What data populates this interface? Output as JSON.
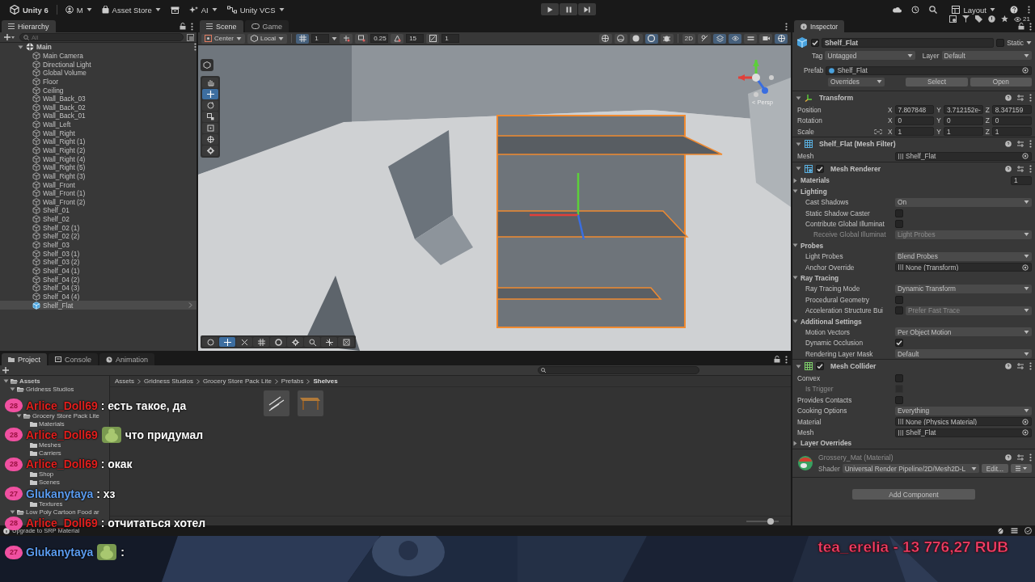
{
  "toolbar": {
    "title": "Unity 6",
    "account": "M",
    "asset_store": "Asset Store",
    "ai": "AI",
    "vcs": "Unity VCS",
    "layout": "Layout"
  },
  "hierarchy": {
    "title": "Hierarchy",
    "placeholder": "All",
    "items": [
      {
        "label": "Main",
        "expanded": true,
        "children": [
          {
            "label": "Main Camera",
            "selected": false,
            "prefab": false
          },
          {
            "label": "Directional Light",
            "selected": false,
            "prefab": false
          },
          {
            "label": "Global Volume",
            "selected": false,
            "prefab": false
          },
          {
            "label": "Floor",
            "selected": false,
            "prefab": false
          },
          {
            "label": "Ceiling",
            "selected": false,
            "prefab": false
          },
          {
            "label": "Wall_Back_03",
            "selected": false,
            "prefab": false
          },
          {
            "label": "Wall_Back_02",
            "selected": false,
            "prefab": false
          },
          {
            "label": "Wall_Back_01",
            "selected": false,
            "prefab": false
          },
          {
            "label": "Wall_Left",
            "selected": false,
            "prefab": false
          },
          {
            "label": "Wall_Right",
            "selected": false,
            "prefab": false
          },
          {
            "label": "Wall_Right (1)",
            "selected": false,
            "prefab": false
          },
          {
            "label": "Wall_Right (2)",
            "selected": false,
            "prefab": false
          },
          {
            "label": "Wall_Right (4)",
            "selected": false,
            "prefab": false
          },
          {
            "label": "Wall_Right (5)",
            "selected": false,
            "prefab": false
          },
          {
            "label": "Wall_Right (3)",
            "selected": false,
            "prefab": false
          },
          {
            "label": "Wall_Front",
            "selected": false,
            "prefab": false
          },
          {
            "label": "Wall_Front (1)",
            "selected": false,
            "prefab": false
          },
          {
            "label": "Wall_Front (2)",
            "selected": false,
            "prefab": false
          },
          {
            "label": "Shelf_01",
            "selected": false,
            "prefab": false
          },
          {
            "label": "Shelf_02",
            "selected": false,
            "prefab": false
          },
          {
            "label": "Shelf_02 (1)",
            "selected": false,
            "prefab": false
          },
          {
            "label": "Shelf_02 (2)",
            "selected": false,
            "prefab": false
          },
          {
            "label": "Shelf_03",
            "selected": false,
            "prefab": false
          },
          {
            "label": "Shelf_03 (1)",
            "selected": false,
            "prefab": false
          },
          {
            "label": "Shelf_03 (2)",
            "selected": false,
            "prefab": false
          },
          {
            "label": "Shelf_04 (1)",
            "selected": false,
            "prefab": false
          },
          {
            "label": "Shelf_04 (2)",
            "selected": false,
            "prefab": false
          },
          {
            "label": "Shelf_04 (3)",
            "selected": false,
            "prefab": false
          },
          {
            "label": "Shelf_04 (4)",
            "selected": false,
            "prefab": false
          },
          {
            "label": "Shelf_Flat",
            "selected": true,
            "prefab": true
          }
        ]
      }
    ]
  },
  "scene": {
    "tabs": [
      {
        "label": "Scene",
        "selected": true
      },
      {
        "label": "Game",
        "selected": false
      }
    ],
    "pivot": "Center",
    "space": "Local",
    "grid_size": "1",
    "snap": "0.25",
    "angle": "15",
    "scale_snap": "1",
    "mode_2d": "2D",
    "persp": "< Persp"
  },
  "inspector": {
    "title": "Inspector",
    "object_name": "Shelf_Flat",
    "active": true,
    "static_label": "Static",
    "static": false,
    "tag_label": "Tag",
    "tag": "Untagged",
    "layer_label": "Layer",
    "layer": "Default",
    "prefab_label": "Prefab",
    "prefab": "Shelf_Flat",
    "overrides": "Overrides",
    "select": "Select",
    "open": "Open",
    "components": [
      {
        "kind": "transform",
        "title": "Transform",
        "expanded": true,
        "rows": [
          {
            "kind": "vector",
            "label": "Position",
            "values": [
              {
                "axis": "X",
                "value": "7.807848"
              },
              {
                "axis": "Y",
                "value": "3.712152e-"
              },
              {
                "axis": "Z",
                "value": "8.347159"
              }
            ]
          },
          {
            "kind": "vector",
            "label": "Rotation",
            "values": [
              {
                "axis": "X",
                "value": "0"
              },
              {
                "axis": "Y",
                "value": "0"
              },
              {
                "axis": "Z",
                "value": "0"
              }
            ]
          },
          {
            "kind": "vector",
            "label": "Scale",
            "constrain": true,
            "values": [
              {
                "axis": "X",
                "value": "1"
              },
              {
                "axis": "Y",
                "value": "1"
              },
              {
                "axis": "Z",
                "value": "1"
              }
            ]
          }
        ]
      },
      {
        "kind": "filter",
        "title": "Shelf_Flat (Mesh Filter)",
        "expanded": true,
        "rows": [
          {
            "kind": "object",
            "label": "Mesh",
            "value": "Shelf_Flat"
          }
        ]
      },
      {
        "kind": "renderer",
        "title": "Mesh Renderer",
        "enabled": true,
        "expanded": true,
        "rows": [
          {
            "kind": "section",
            "label": "Materials",
            "expanded": false,
            "value": "1"
          },
          {
            "kind": "section",
            "label": "Lighting",
            "expanded": true,
            "rows": [
              {
                "kind": "dropdown",
                "label": "Cast Shadows",
                "value": "On",
                "disabled": false
              },
              {
                "kind": "checkbox",
                "label": "Static Shadow Caster",
                "checked": false,
                "disabled": false
              },
              {
                "kind": "checkbox",
                "label": "Contribute Global Illuminat",
                "checked": false,
                "disabled": false,
                "rows": [
                  {
                    "kind": "dropdown",
                    "label": "Receive Global Illuminat",
                    "value": "Light Probes",
                    "disabled": true
                  }
                ]
              }
            ]
          },
          {
            "kind": "section",
            "label": "Probes",
            "expanded": true,
            "rows": [
              {
                "kind": "dropdown",
                "label": "Light Probes",
                "value": "Blend Probes",
                "disabled": false
              },
              {
                "kind": "object",
                "label": "Anchor Override",
                "value": "None (Transform)"
              }
            ]
          },
          {
            "kind": "section",
            "label": "Ray Tracing",
            "expanded": true,
            "rows": [
              {
                "kind": "dropdown",
                "label": "Ray Tracing Mode",
                "value": "Dynamic Transform",
                "disabled": false
              },
              {
                "kind": "checkbox",
                "label": "Procedural Geometry",
                "checked": false,
                "disabled": false
              },
              {
                "kind": "checkdrop",
                "label": "Acceleration Structure Bui",
                "checked": false,
                "value": "Prefer Fast Trace"
              }
            ]
          },
          {
            "kind": "section",
            "label": "Additional Settings",
            "expanded": true,
            "rows": [
              {
                "kind": "dropdown",
                "label": "Motion Vectors",
                "value": "Per Object Motion",
                "disabled": false
              },
              {
                "kind": "checkbox",
                "label": "Dynamic Occlusion",
                "checked": true,
                "disabled": false
              },
              {
                "kind": "dropdown",
                "label": "Rendering Layer Mask",
                "value": "Default",
                "disabled": false
              }
            ]
          }
        ]
      },
      {
        "kind": "collider",
        "title": "Mesh Collider",
        "enabled": true,
        "expanded": true,
        "rows": [
          {
            "kind": "checkbox",
            "label": "Convex",
            "checked": false,
            "disabled": false,
            "rows": [
              {
                "kind": "checkbox",
                "label": "Is Trigger",
                "checked": false,
                "disabled": true
              }
            ]
          },
          {
            "kind": "checkbox",
            "label": "Provides Contacts",
            "checked": false,
            "disabled": false
          },
          {
            "kind": "dropdown",
            "label": "Cooking Options",
            "value": "Everything",
            "disabled": false
          },
          {
            "kind": "object",
            "label": "Material",
            "value": "None (Physics Material)"
          },
          {
            "kind": "object",
            "label": "Mesh",
            "value": "Shelf_Flat"
          },
          {
            "kind": "section",
            "label": "Layer Overrides",
            "expanded": false
          }
        ]
      }
    ],
    "material": {
      "name": "Grossery_Mat (Material)",
      "shader_label": "Shader",
      "shader": "Universal Render Pipeline/2D/Mesh2D-L",
      "edit": "Edit..."
    },
    "add_component": "Add Component"
  },
  "project": {
    "tabs": [
      {
        "label": "Project",
        "selected": true
      },
      {
        "label": "Console",
        "selected": false
      },
      {
        "label": "Animation",
        "selected": false
      }
    ],
    "tree": [
      {
        "label": "Assets",
        "expanded": true,
        "children": [
          {
            "label": "Gridness Studios",
            "expanded": true,
            "children": [
              {
                "label": "Grocery Store Pack Lite",
                "expanded": true,
                "children": [
                  {
                    "label": "Materials"
                  },
                  {
                    "label": "Meshes"
                  },
                  {
                    "label": "Carriers"
                  },
                  {
                    "label": "Shop"
                  },
                  {
                    "label": "Scenes"
                  },
                  {
                    "label": "Textures"
                  }
                ]
              }
            ]
          },
          {
            "label": "Low Poly Cartoon Food ar",
            "expanded": true
          }
        ]
      }
    ],
    "breadcrumb": [
      "Assets",
      "Gridness Studios",
      "Grocery Store Pack Lite",
      "Prefabs",
      "Shelves"
    ],
    "hidden_count": "21",
    "thumb_size": {
      "level": 0.75
    },
    "status": "Upgrade to SRP Material"
  },
  "chat": [
    {
      "badge": "28",
      "user": "Arlice_Doll69",
      "color": "#e0201e",
      "emote": false,
      "text": ": есть такое, да"
    },
    {
      "badge": "28",
      "user": "Arlice_Doll69",
      "color": "#e0201e",
      "emote": true,
      "text": "что придумал"
    },
    {
      "badge": "28",
      "user": "Arlice_Doll69",
      "color": "#e0201e",
      "emote": false,
      "text": ": окак"
    },
    {
      "badge": "27",
      "user": "Glukanytaya",
      "color": "#5b9cf0",
      "emote": false,
      "text": ": хз"
    },
    {
      "badge": "28",
      "user": "Arlice_Doll69",
      "color": "#e0201e",
      "emote": false,
      "text": ": отчитаться хотел"
    },
    {
      "badge": "27",
      "user": "Glukanytaya",
      "color": "#5b9cf0",
      "emote": true,
      "text": ":"
    }
  ],
  "donation": "tea_erelia - 13 776,27 RUB"
}
